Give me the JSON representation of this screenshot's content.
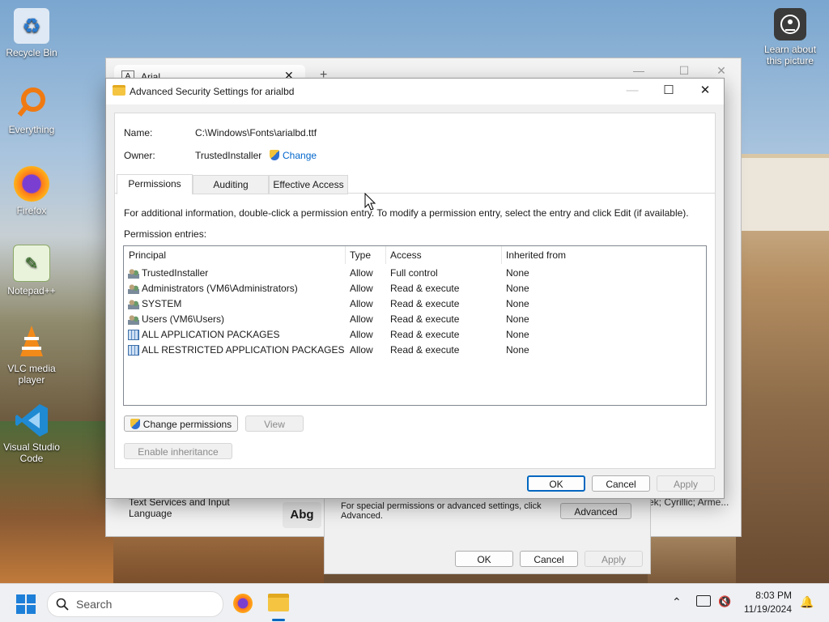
{
  "desktop": {
    "icons": [
      {
        "label": "Recycle Bin",
        "icon": "recycle-bin-icon"
      },
      {
        "label": "Everything",
        "icon": "magnifier-icon"
      },
      {
        "label": "Firefox",
        "icon": "firefox-icon"
      },
      {
        "label": "Notepad++",
        "icon": "notepad-icon"
      },
      {
        "label": "VLC media player",
        "icon": "vlc-cone-icon"
      },
      {
        "label": "Visual Studio Code",
        "icon": "vscode-icon"
      }
    ],
    "learn_label": "Learn about this picture"
  },
  "back_window": {
    "tab_title": "Arial",
    "new_tab": "+",
    "footer_left": "Text Services and Input Language",
    "abg": "Abg",
    "footer_right": "ek; Cyrillic; Arme..."
  },
  "lower_dialog": {
    "text": "For special permissions or advanced settings, click Advanced.",
    "advanced_btn": "Advanced",
    "ok": "OK",
    "cancel": "Cancel",
    "apply": "Apply"
  },
  "dialog": {
    "title": "Advanced Security Settings for arialbd",
    "name_label": "Name:",
    "name_value": "C:\\Windows\\Fonts\\arialbd.ttf",
    "owner_label": "Owner:",
    "owner_value": "TrustedInstaller",
    "change_link": "Change",
    "tabs": [
      "Permissions",
      "Auditing",
      "Effective Access"
    ],
    "info": "For additional information, double-click a permission entry. To modify a permission entry, select the entry and click Edit (if available).",
    "entries_label": "Permission entries:",
    "columns": [
      "Principal",
      "Type",
      "Access",
      "Inherited from"
    ],
    "rows": [
      {
        "principal": "TrustedInstaller",
        "type": "Allow",
        "access": "Full control",
        "inherited": "None",
        "icon": "users"
      },
      {
        "principal": "Administrators (VM6\\Administrators)",
        "type": "Allow",
        "access": "Read & execute",
        "inherited": "None",
        "icon": "users"
      },
      {
        "principal": "SYSTEM",
        "type": "Allow",
        "access": "Read & execute",
        "inherited": "None",
        "icon": "users"
      },
      {
        "principal": "Users (VM6\\Users)",
        "type": "Allow",
        "access": "Read & execute",
        "inherited": "None",
        "icon": "users"
      },
      {
        "principal": "ALL APPLICATION PACKAGES",
        "type": "Allow",
        "access": "Read & execute",
        "inherited": "None",
        "icon": "pkg"
      },
      {
        "principal": "ALL RESTRICTED APPLICATION PACKAGES",
        "type": "Allow",
        "access": "Read & execute",
        "inherited": "None",
        "icon": "pkg"
      }
    ],
    "change_permissions": "Change permissions",
    "view": "View",
    "enable_inheritance": "Enable inheritance",
    "ok": "OK",
    "cancel": "Cancel",
    "apply": "Apply"
  },
  "taskbar": {
    "search_placeholder": "Search",
    "time": "8:03 PM",
    "date": "11/19/2024"
  }
}
